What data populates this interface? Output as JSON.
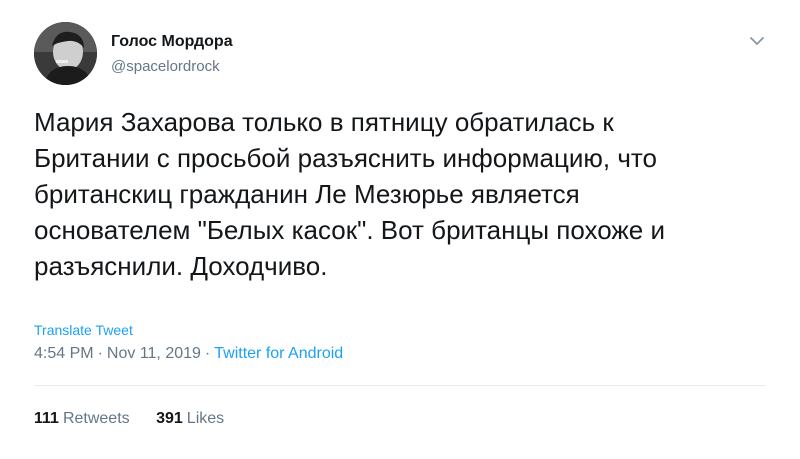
{
  "author": {
    "display_name": "Голос Мордора",
    "handle": "@spacelordrock",
    "avatar": "avatar-photo"
  },
  "tweet": {
    "text": "Мария Захарова только в пятницу обратилась к\nБритании с просьбой разъяснить информацию, что\nбританскиц гражданин Ле Мезюрье является\nоснователем \"Белых касок\". Вот британцы похоже и\nразъяснили. Доходчиво.",
    "translate_label": "Translate Tweet",
    "time": "4:54 PM",
    "date": "Nov 11, 2019",
    "separator": "·",
    "source": "Twitter for Android"
  },
  "stats": {
    "retweets_count": "111",
    "retweets_label": "Retweets",
    "likes_count": "391",
    "likes_label": "Likes"
  },
  "icons": {
    "menu": "chevron-down-icon"
  },
  "colors": {
    "text": "#14171a",
    "secondary": "#657786",
    "link": "#1da1f2",
    "divider": "#e6ecf0"
  }
}
